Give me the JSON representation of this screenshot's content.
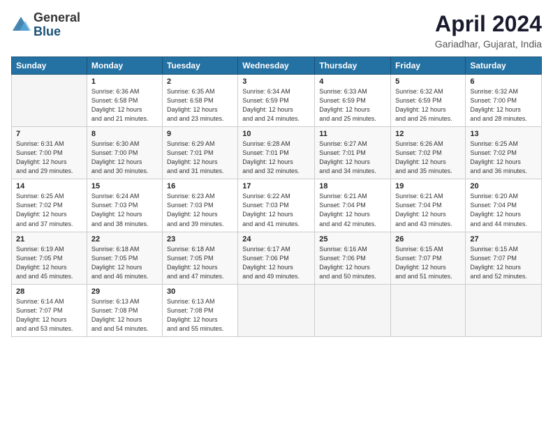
{
  "logo": {
    "general": "General",
    "blue": "Blue"
  },
  "title": "April 2024",
  "location": "Gariadhar, Gujarat, India",
  "headers": [
    "Sunday",
    "Monday",
    "Tuesday",
    "Wednesday",
    "Thursday",
    "Friday",
    "Saturday"
  ],
  "weeks": [
    [
      {
        "num": "",
        "sunrise": "",
        "sunset": "",
        "daylight": ""
      },
      {
        "num": "1",
        "sunrise": "Sunrise: 6:36 AM",
        "sunset": "Sunset: 6:58 PM",
        "daylight": "Daylight: 12 hours and 21 minutes."
      },
      {
        "num": "2",
        "sunrise": "Sunrise: 6:35 AM",
        "sunset": "Sunset: 6:58 PM",
        "daylight": "Daylight: 12 hours and 23 minutes."
      },
      {
        "num": "3",
        "sunrise": "Sunrise: 6:34 AM",
        "sunset": "Sunset: 6:59 PM",
        "daylight": "Daylight: 12 hours and 24 minutes."
      },
      {
        "num": "4",
        "sunrise": "Sunrise: 6:33 AM",
        "sunset": "Sunset: 6:59 PM",
        "daylight": "Daylight: 12 hours and 25 minutes."
      },
      {
        "num": "5",
        "sunrise": "Sunrise: 6:32 AM",
        "sunset": "Sunset: 6:59 PM",
        "daylight": "Daylight: 12 hours and 26 minutes."
      },
      {
        "num": "6",
        "sunrise": "Sunrise: 6:32 AM",
        "sunset": "Sunset: 7:00 PM",
        "daylight": "Daylight: 12 hours and 28 minutes."
      }
    ],
    [
      {
        "num": "7",
        "sunrise": "Sunrise: 6:31 AM",
        "sunset": "Sunset: 7:00 PM",
        "daylight": "Daylight: 12 hours and 29 minutes."
      },
      {
        "num": "8",
        "sunrise": "Sunrise: 6:30 AM",
        "sunset": "Sunset: 7:00 PM",
        "daylight": "Daylight: 12 hours and 30 minutes."
      },
      {
        "num": "9",
        "sunrise": "Sunrise: 6:29 AM",
        "sunset": "Sunset: 7:01 PM",
        "daylight": "Daylight: 12 hours and 31 minutes."
      },
      {
        "num": "10",
        "sunrise": "Sunrise: 6:28 AM",
        "sunset": "Sunset: 7:01 PM",
        "daylight": "Daylight: 12 hours and 32 minutes."
      },
      {
        "num": "11",
        "sunrise": "Sunrise: 6:27 AM",
        "sunset": "Sunset: 7:01 PM",
        "daylight": "Daylight: 12 hours and 34 minutes."
      },
      {
        "num": "12",
        "sunrise": "Sunrise: 6:26 AM",
        "sunset": "Sunset: 7:02 PM",
        "daylight": "Daylight: 12 hours and 35 minutes."
      },
      {
        "num": "13",
        "sunrise": "Sunrise: 6:25 AM",
        "sunset": "Sunset: 7:02 PM",
        "daylight": "Daylight: 12 hours and 36 minutes."
      }
    ],
    [
      {
        "num": "14",
        "sunrise": "Sunrise: 6:25 AM",
        "sunset": "Sunset: 7:02 PM",
        "daylight": "Daylight: 12 hours and 37 minutes."
      },
      {
        "num": "15",
        "sunrise": "Sunrise: 6:24 AM",
        "sunset": "Sunset: 7:03 PM",
        "daylight": "Daylight: 12 hours and 38 minutes."
      },
      {
        "num": "16",
        "sunrise": "Sunrise: 6:23 AM",
        "sunset": "Sunset: 7:03 PM",
        "daylight": "Daylight: 12 hours and 39 minutes."
      },
      {
        "num": "17",
        "sunrise": "Sunrise: 6:22 AM",
        "sunset": "Sunset: 7:03 PM",
        "daylight": "Daylight: 12 hours and 41 minutes."
      },
      {
        "num": "18",
        "sunrise": "Sunrise: 6:21 AM",
        "sunset": "Sunset: 7:04 PM",
        "daylight": "Daylight: 12 hours and 42 minutes."
      },
      {
        "num": "19",
        "sunrise": "Sunrise: 6:21 AM",
        "sunset": "Sunset: 7:04 PM",
        "daylight": "Daylight: 12 hours and 43 minutes."
      },
      {
        "num": "20",
        "sunrise": "Sunrise: 6:20 AM",
        "sunset": "Sunset: 7:04 PM",
        "daylight": "Daylight: 12 hours and 44 minutes."
      }
    ],
    [
      {
        "num": "21",
        "sunrise": "Sunrise: 6:19 AM",
        "sunset": "Sunset: 7:05 PM",
        "daylight": "Daylight: 12 hours and 45 minutes."
      },
      {
        "num": "22",
        "sunrise": "Sunrise: 6:18 AM",
        "sunset": "Sunset: 7:05 PM",
        "daylight": "Daylight: 12 hours and 46 minutes."
      },
      {
        "num": "23",
        "sunrise": "Sunrise: 6:18 AM",
        "sunset": "Sunset: 7:05 PM",
        "daylight": "Daylight: 12 hours and 47 minutes."
      },
      {
        "num": "24",
        "sunrise": "Sunrise: 6:17 AM",
        "sunset": "Sunset: 7:06 PM",
        "daylight": "Daylight: 12 hours and 49 minutes."
      },
      {
        "num": "25",
        "sunrise": "Sunrise: 6:16 AM",
        "sunset": "Sunset: 7:06 PM",
        "daylight": "Daylight: 12 hours and 50 minutes."
      },
      {
        "num": "26",
        "sunrise": "Sunrise: 6:15 AM",
        "sunset": "Sunset: 7:07 PM",
        "daylight": "Daylight: 12 hours and 51 minutes."
      },
      {
        "num": "27",
        "sunrise": "Sunrise: 6:15 AM",
        "sunset": "Sunset: 7:07 PM",
        "daylight": "Daylight: 12 hours and 52 minutes."
      }
    ],
    [
      {
        "num": "28",
        "sunrise": "Sunrise: 6:14 AM",
        "sunset": "Sunset: 7:07 PM",
        "daylight": "Daylight: 12 hours and 53 minutes."
      },
      {
        "num": "29",
        "sunrise": "Sunrise: 6:13 AM",
        "sunset": "Sunset: 7:08 PM",
        "daylight": "Daylight: 12 hours and 54 minutes."
      },
      {
        "num": "30",
        "sunrise": "Sunrise: 6:13 AM",
        "sunset": "Sunset: 7:08 PM",
        "daylight": "Daylight: 12 hours and 55 minutes."
      },
      {
        "num": "",
        "sunrise": "",
        "sunset": "",
        "daylight": ""
      },
      {
        "num": "",
        "sunrise": "",
        "sunset": "",
        "daylight": ""
      },
      {
        "num": "",
        "sunrise": "",
        "sunset": "",
        "daylight": ""
      },
      {
        "num": "",
        "sunrise": "",
        "sunset": "",
        "daylight": ""
      }
    ]
  ]
}
